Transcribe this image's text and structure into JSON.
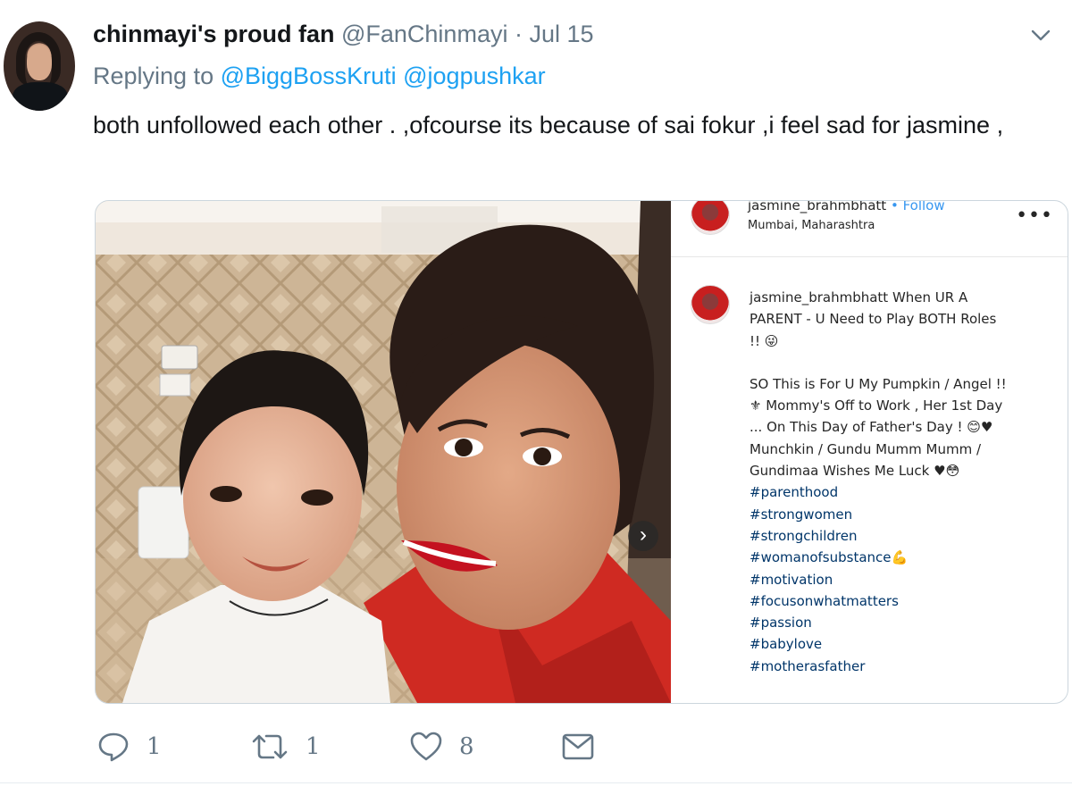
{
  "tweet": {
    "author_name": "chinmayi's proud fan",
    "author_handle": "@FanChinmayi",
    "separator": "·",
    "date": "Jul 15",
    "replying_prefix": "Replying to",
    "reply_mentions": [
      "@BiggBossKruti",
      "@jogpushkar"
    ],
    "text": "both unfollowed each other . ,ofcourse its because of sai fokur ,i feel sad for jasmine ,"
  },
  "embed": {
    "username": "jasmine_brahmbhatt",
    "follow": "• Follow",
    "location": "Mumbai, Maharashtra",
    "more": "•••",
    "caption_lines": [
      "When UR A",
      "PARENT - U Need to Play BOTH Roles",
      "!! 😜"
    ],
    "body_lines": [
      "SO This is For U My Pumpkin / Angel !!",
      "⚜ Mommy's Off to Work , Her 1st Day",
      "... On This Day of Father's Day ! 😊♥",
      "Munchkin / Gundu Mumm Mumm /",
      "Gundimaa Wishes Me Luck ♥😳"
    ],
    "hashtags": [
      "#parenthood",
      "#strongwomen",
      "#strongchildren",
      "#womanofsubstance💪",
      "#motivation",
      "#focusonwhatmatters",
      "#passion",
      "#babylove",
      "#motherasfather"
    ],
    "next_arrow": "›"
  },
  "actions": {
    "reply_count": "1",
    "retweet_count": "1",
    "like_count": "8"
  },
  "icons": {
    "avatar": "profile-photo",
    "chevron": "chevron-down-icon",
    "reply": "reply-icon",
    "retweet": "retweet-icon",
    "like": "heart-icon",
    "dm": "envelope-icon"
  },
  "colors": {
    "link": "#1da1f2",
    "muted": "#657786",
    "ig_link": "#003569"
  }
}
